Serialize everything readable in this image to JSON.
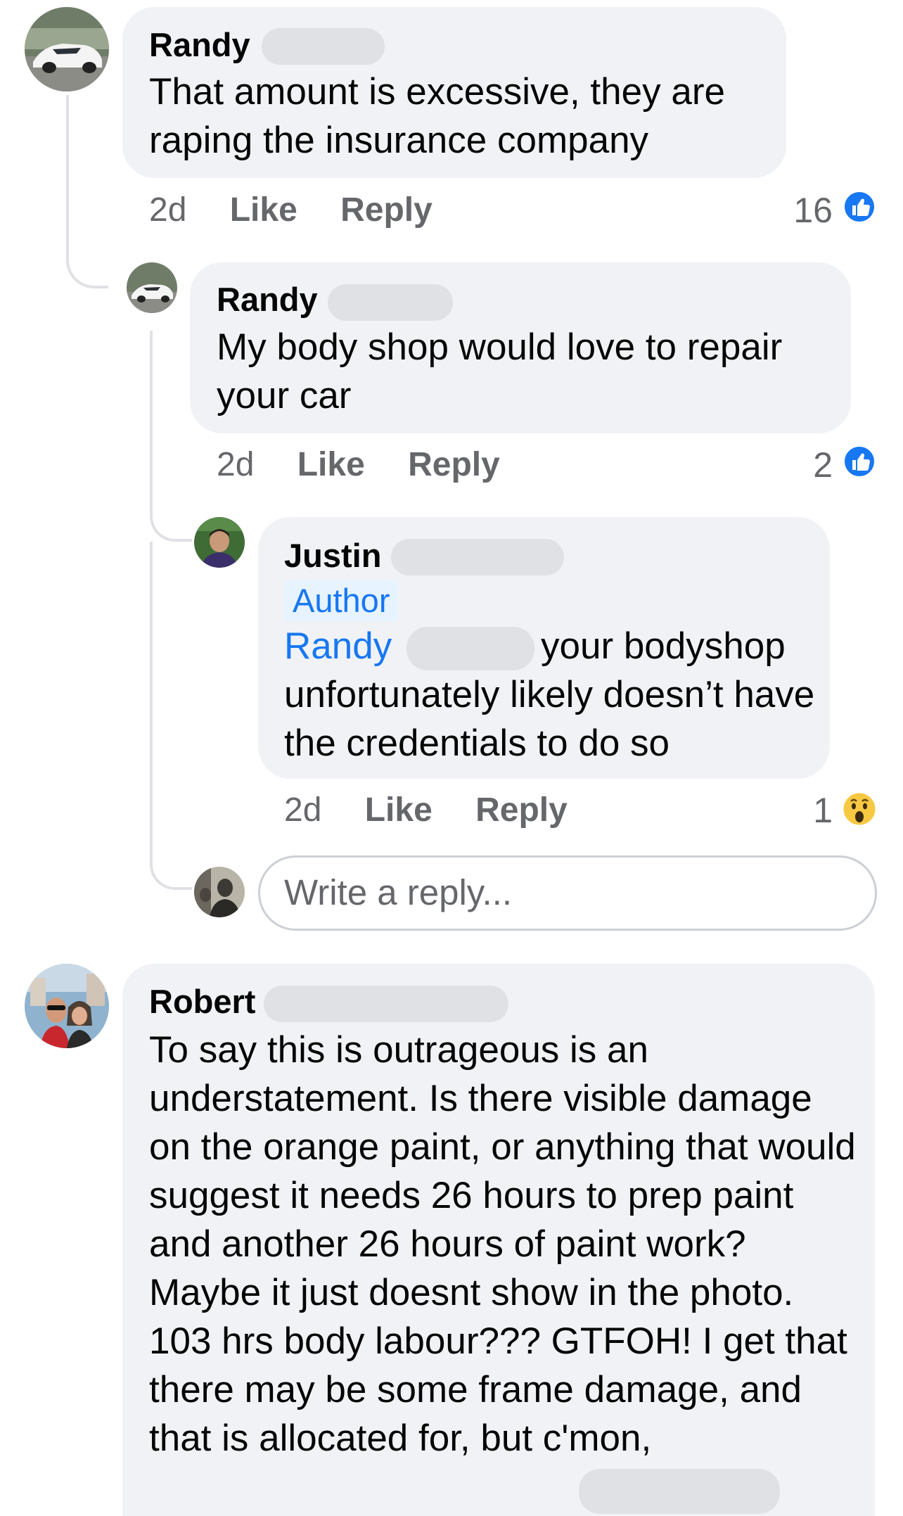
{
  "comments": {
    "c1": {
      "author": "Randy",
      "text": "That amount is excessive, they are raping the insurance company",
      "time": "2d",
      "like_label": "Like",
      "reply_label": "Reply",
      "reaction_count": "16",
      "reaction_icon": "like-icon"
    },
    "c2": {
      "author": "Randy",
      "text": "My body shop would love to repair your car",
      "time": "2d",
      "like_label": "Like",
      "reply_label": "Reply",
      "reaction_count": "2",
      "reaction_icon": "like-icon"
    },
    "c3": {
      "author": "Justin",
      "badge": "Author",
      "mention": "Randy",
      "text_line1": "your bodyshop",
      "text_rest": "unfortunately likely doesn’t have the credentials to do so",
      "time": "2d",
      "like_label": "Like",
      "reply_label": "Reply",
      "reaction_count": "1",
      "reaction_icon": "wow-icon"
    },
    "c4": {
      "author": "Robert",
      "text": "To say this is outrageous is an understatement.  Is there visible damage on the orange paint, or anything that would suggest it needs 26 hours to prep paint and another 26 hours of paint work? Maybe it just doesnt show in the photo. 103 hrs body labour??? GTFOH! I get that there may be some frame damage, and that is allocated for, but c'mon,"
    }
  },
  "reply_box": {
    "placeholder": "Write a reply..."
  },
  "colors": {
    "bubble": "#f0f2f5",
    "link": "#1877f2",
    "secondary_text": "#65676b",
    "thread_line": "#dfe1e5"
  }
}
